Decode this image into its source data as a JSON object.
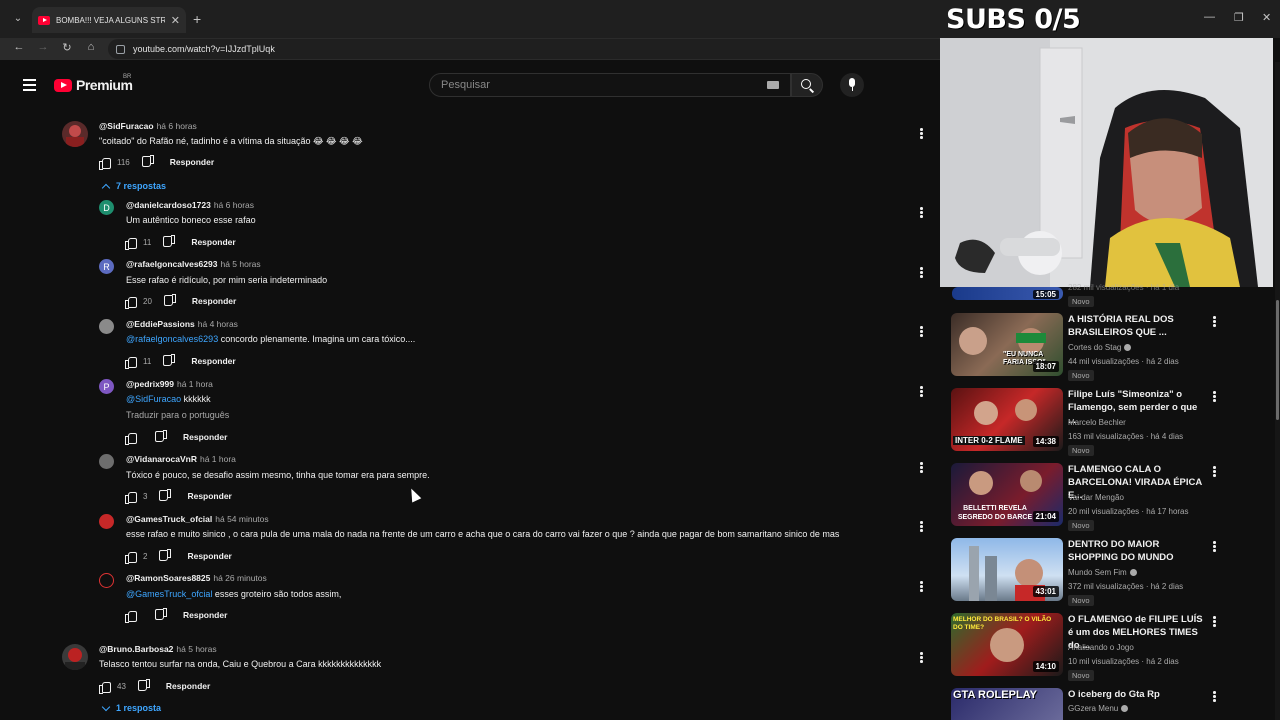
{
  "browser": {
    "tab_title": "BOMBA!!! VEJA ALGUNS STREA...",
    "tab_close": "✕",
    "new_tab": "+",
    "url": "youtube.com/watch?v=IJJzdTplUqk",
    "controls": {
      "minimize": "—",
      "restore": "❐",
      "close": "✕"
    }
  },
  "overlay": {
    "subs": "SUBS 0/5"
  },
  "masthead": {
    "logo": "Premium",
    "region": "BR",
    "search_placeholder": "Pesquisar"
  },
  "comments": [
    {
      "author": "@SidFuracao",
      "time": "há 6 horas",
      "text": "\"coitado\" do Rafão né, tadinho é a vítima da situação 😂 😂 😂 😂",
      "likes": "116",
      "reply": "Responder",
      "replies_toggle": "7 respostas"
    },
    {
      "author": "@danielcardoso1723",
      "time": "há 6 horas",
      "text": "Um autêntico boneco esse rafao",
      "likes": "11",
      "reply": "Responder",
      "initial": "D"
    },
    {
      "author": "@rafaelgoncalves6293",
      "time": "há 5 horas",
      "text": "Esse rafao é ridículo, por mim seria indeterminado",
      "likes": "20",
      "reply": "Responder",
      "initial": "R"
    },
    {
      "author": "@EddiePassions",
      "time": "há 4 horas",
      "mention": "@rafaelgoncalves6293",
      "text": " concordo plenamente. Imagina um cara tóxico....",
      "likes": "11",
      "reply": "Responder"
    },
    {
      "author": "@pedrix999",
      "time": "há 1 hora",
      "mention": "@SidFuracao",
      "text": "  kkkkkk",
      "translate": "Traduzir para o português",
      "likes": "",
      "reply": "Responder",
      "initial": "P"
    },
    {
      "author": "@VidanarocaVnR",
      "time": "há 1 hora",
      "text": "Tóxico é pouco, se desafio assim mesmo, tinha que tomar era para sempre.",
      "likes": "3",
      "reply": "Responder"
    },
    {
      "author": "@GamesTruck_ofcial",
      "time": "há 54 minutos",
      "text": "esse rafao e muito sinico , o cara pula de uma mala do nada na frente de um carro e acha que o cara do carro vai fazer o que ?  ainda que pagar de bom samaritano sinico de mas",
      "likes": "2",
      "reply": "Responder"
    },
    {
      "author": "@RamonSoares8825",
      "time": "há 26 minutos",
      "mention": "@GamesTruck_ofcial",
      "text": " esses groteiro são todos assim,",
      "likes": "",
      "reply": "Responder"
    },
    {
      "author": "@Bruno.Barbosa2",
      "time": "há 5 horas",
      "text": "Telasco tentou surfar na onda, Caiu e Quebrou a Cara  kkkkkkkkkkkkkk",
      "likes": "43",
      "reply": "Responder",
      "replies_toggle": "1 resposta"
    }
  ],
  "sidebar": {
    "partial": {
      "duration": "15:05",
      "meta": "282 mil visualizações · há 1 dia",
      "badge": "Novo"
    },
    "videos": [
      {
        "title": "A HISTÓRIA REAL DOS BRASILEIROS QUE ...",
        "channel": "Cortes do Stag",
        "meta": "44 mil visualizações · há 2 dias",
        "badge": "Novo",
        "duration": "18:07",
        "thumb_text": "\"EU NUNCA FARIA ISSO\""
      },
      {
        "title": "Filipe Luís \"Simeoniza\" o Flamengo, sem perder o que ...",
        "channel": "Marcelo Bechler",
        "meta": "163 mil visualizações · há 4 dias",
        "badge": "Novo",
        "duration": "14:38",
        "thumb_text": "INTER 0-2 FLAME"
      },
      {
        "title": "FLAMENGO CALA O BARCELONA! VIRADA ÉPICA E...",
        "channel": "Vai dar Mengão",
        "meta": "20 mil visualizações · há 17 horas",
        "badge": "Novo",
        "duration": "21:04",
        "thumb_text": "BELLETTI REVELA SEGREDO DO BARCE"
      },
      {
        "title": "DENTRO DO MAIOR SHOPPING DO MUNDO",
        "channel": "Mundo Sem Fim",
        "meta": "372 mil visualizações · há 2 dias",
        "badge": "Novo",
        "duration": "43:01",
        "thumb_text": ""
      },
      {
        "title": "O FLAMENGO de FILIPE LUÍS é um dos MELHORES TIMES do ...",
        "channel": "Analisando o Jogo",
        "meta": "10 mil visualizações · há 2 dias",
        "badge": "Novo",
        "duration": "14:10",
        "thumb_text": "MELHOR DO BRASIL? O VILÃO DO TIME?"
      },
      {
        "title": "O iceberg do Gta Rp",
        "channel": "GGzera Menu",
        "meta": "",
        "badge": "",
        "duration": "",
        "thumb_text": "GTA ROLEPLAY"
      }
    ]
  },
  "colors": {
    "bg": "#0f0f0f",
    "accent": "#ff0033",
    "link": "#3ea6ff"
  }
}
